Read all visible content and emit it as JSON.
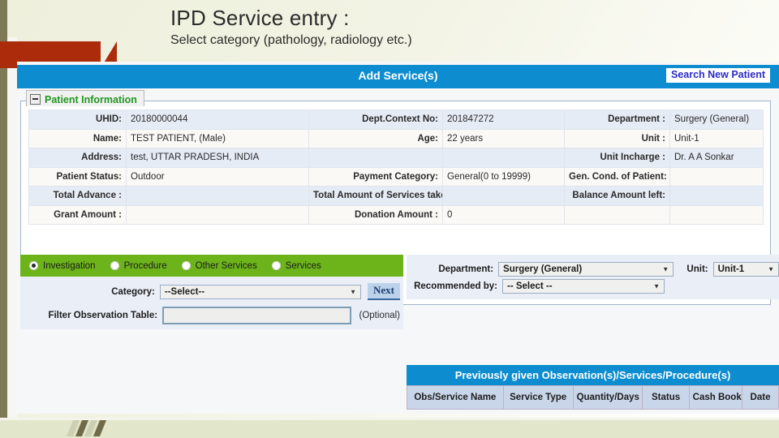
{
  "slide": {
    "title": "IPD Service entry :",
    "subtitle": "Select category (pathology, radiology etc.)"
  },
  "app": {
    "header_title": "Add Service(s)",
    "search_new_patient_label": "Search New Patient",
    "accent_blue": "#0d8dcf",
    "accent_green": "#6cb41a",
    "legend_green": "#1f9620"
  },
  "patient_information": {
    "legend": "Patient Information",
    "rows": [
      [
        {
          "label": "UHID:",
          "value": "20180000044"
        },
        {
          "label": "Dept.Context No:",
          "value": "201847272"
        },
        {
          "label": "Department :",
          "value": "Surgery (General)"
        }
      ],
      [
        {
          "label": "Name:",
          "value": "TEST PATIENT, (Male)"
        },
        {
          "label": "Age:",
          "value": "22 years"
        },
        {
          "label": "Unit :",
          "value": "Unit-1"
        }
      ],
      [
        {
          "label": "Address:",
          "value": "test, UTTAR PRADESH, INDIA"
        },
        {
          "label": "",
          "value": ""
        },
        {
          "label": "Unit Incharge :",
          "value": "Dr. A A Sonkar"
        }
      ],
      [
        {
          "label": "Patient Status:",
          "value": "Outdoor"
        },
        {
          "label": "Payment Category:",
          "value": "General(0 to 19999)"
        },
        {
          "label": "Gen. Cond. of Patient:",
          "value": ""
        }
      ],
      [
        {
          "label": "Total Advance :",
          "value": ""
        },
        {
          "label": "Total Amount of Services taken :",
          "value": ""
        },
        {
          "label": "Balance Amount left:",
          "value": ""
        }
      ],
      [
        {
          "label": "Grant Amount :",
          "value": ""
        },
        {
          "label": "Donation Amount :",
          "value": "0"
        },
        {
          "label": "",
          "value": ""
        }
      ]
    ]
  },
  "service_type_radios": [
    {
      "label": "Investigation",
      "selected": true
    },
    {
      "label": "Procedure",
      "selected": false
    },
    {
      "label": "Other Services",
      "selected": false
    },
    {
      "label": "Services",
      "selected": false
    }
  ],
  "left_form": {
    "category_label": "Category:",
    "category_value": "--Select--",
    "next_label": "Next",
    "filter_label": "Filter Observation Table:",
    "filter_value": "",
    "filter_placeholder": "",
    "optional_note": "(Optional)"
  },
  "right_form": {
    "department_label": "Department:",
    "department_value": "Surgery (General)",
    "unit_label": "Unit:",
    "unit_value": "Unit-1",
    "recommended_label": "Recommended by:",
    "recommended_value": "-- Select --"
  },
  "previous_table": {
    "title": "Previously given Observation(s)/Services/Procedure(s)",
    "columns": [
      "Obs/Service Name",
      "Service Type",
      "Quantity/Days",
      "Status",
      "Cash Book",
      "Date"
    ],
    "rows": []
  }
}
